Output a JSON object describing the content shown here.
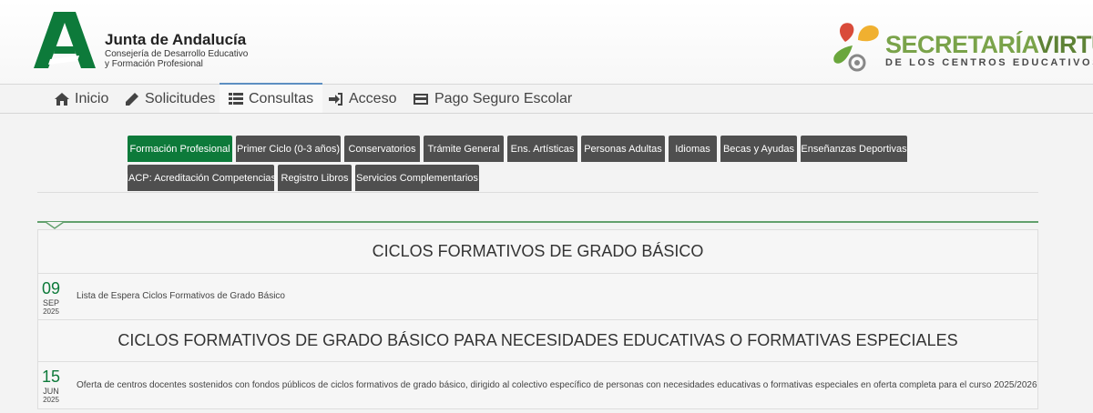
{
  "header": {
    "org_title": "Junta de Andalucía",
    "org_sub1": "Consejería de Desarrollo Educativo",
    "org_sub2": "y Formación Profesional",
    "sv_title_a": "SECRETARÍA",
    "sv_title_b": "VIRTUAL",
    "sv_sub": "DE LOS CENTROS EDUCATIVOS"
  },
  "nav": {
    "items": [
      {
        "label": "Inicio",
        "icon": "home-icon"
      },
      {
        "label": "Solicitudes",
        "icon": "pencil-icon"
      },
      {
        "label": "Consultas",
        "icon": "list-icon"
      },
      {
        "label": "Acceso",
        "icon": "sign-in-icon"
      },
      {
        "label": "Pago Seguro Escolar",
        "icon": "credit-card-icon"
      }
    ],
    "active": "Consultas"
  },
  "categories": [
    "Formación Profesional",
    "Primer Ciclo (0-3 años)",
    "Conservatorios",
    "Trámite General",
    "Ens. Artísticas",
    "Personas Adultas",
    "Idiomas",
    "Becas y Ayudas",
    "Enseñanzas Deportivas",
    "IACP: Acreditación Competencias",
    "Registro Libros",
    "Servicios Complementarios"
  ],
  "colors": {
    "active_tab": "#0d7a3a",
    "tab": "#4f4f4f",
    "accent_line": "#62a06d",
    "nav_active": "#5d8fc2"
  },
  "sections": [
    {
      "title": "CICLOS FORMATIVOS DE GRADO BÁSICO",
      "entries": [
        {
          "day": "09",
          "month": "SEP",
          "year": "2025",
          "text": "Lista de Espera Ciclos Formativos de Grado Básico"
        }
      ]
    },
    {
      "title": "CICLOS FORMATIVOS DE GRADO BÁSICO PARA NECESIDADES EDUCATIVAS O FORMATIVAS ESPECIALES",
      "entries": [
        {
          "day": "15",
          "month": "JUN",
          "year": "2025",
          "text": "Oferta de centros docentes sostenidos con fondos públicos de ciclos formativos de grado básico, dirigido al colectivo específico de personas con necesidades educativas o formativas especiales en oferta completa para el curso 2025/2026"
        }
      ]
    }
  ]
}
